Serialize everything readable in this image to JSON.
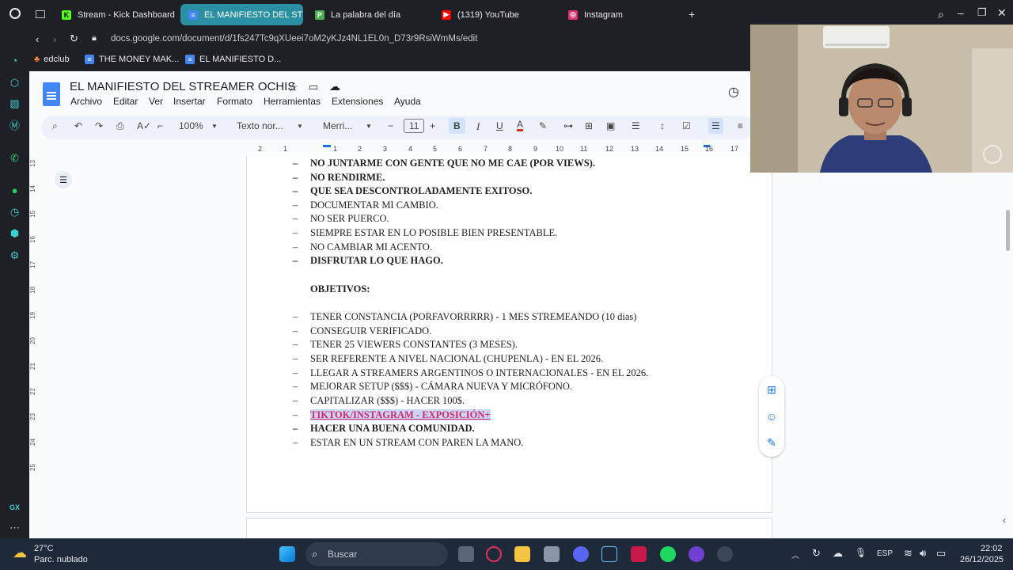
{
  "browser": {
    "tabs": [
      {
        "label": "Stream - Kick Dashboard",
        "icon": "kick-icon",
        "color": "#53fc18"
      },
      {
        "label": "EL MANIFIESTO DEL STR",
        "icon": "docs-icon",
        "color": "#4285f4"
      },
      {
        "label": "La palabra del día",
        "icon": "p-icon",
        "color": "#4caf50"
      },
      {
        "label": "(1319) YouTube",
        "icon": "youtube-icon",
        "color": "#ff0000"
      },
      {
        "label": "Instagram",
        "icon": "instagram-icon",
        "color": "#e1306c"
      }
    ],
    "url": "docs.google.com/document/d/1fs247Tc9qXUeei7oM2yKJz4NL1EL0n_D73r9RsiWmMs/edit",
    "bookmarks": [
      "edclub",
      "THE MONEY MAK...",
      "EL MANIFIESTO D..."
    ]
  },
  "docs": {
    "title": "EL MANIFIESTO DEL STREAMER OCHIS",
    "menu": [
      "Archivo",
      "Editar",
      "Ver",
      "Insertar",
      "Formato",
      "Herramientas",
      "Extensiones",
      "Ayuda"
    ],
    "toolbar": {
      "zoom": "100%",
      "style": "Texto nor...",
      "font": "Merri...",
      "size": "11"
    },
    "ruler_numbers": [
      "2",
      "1",
      "1",
      "2",
      "3",
      "4",
      "5",
      "6",
      "7",
      "8",
      "9",
      "10",
      "11",
      "12",
      "13",
      "14",
      "15",
      "16",
      "17"
    ],
    "vruler_numbers": [
      "13",
      "14",
      "15",
      "16",
      "17",
      "18",
      "19",
      "20",
      "21",
      "22",
      "23",
      "24",
      "25"
    ],
    "lines": [
      {
        "text": "NO JUNTARME CON GENTE QUE NO ME CAE (POR VIEWS).",
        "dash": "–",
        "bold": true
      },
      {
        "text": "NO RENDIRME.",
        "dash": "–",
        "bold": true
      },
      {
        "text": "QUE SEA DESCONTROLADAMENTE EXITOSO.",
        "dash": "–",
        "bold": true
      },
      {
        "text": "DOCUMENTAR MI CAMBIO.",
        "dash": "–",
        "bold": false
      },
      {
        "text": "NO SER PUERCO.",
        "dash": "–",
        "bold": false
      },
      {
        "text": "SIEMPRE ESTAR EN LO POSIBLE BIEN PRESENTABLE.",
        "dash": "–",
        "bold": false
      },
      {
        "text": "NO CAMBIAR MI ACENTO.",
        "dash": "–",
        "bold": false
      },
      {
        "text": "DISFRUTAR LO QUE HAGO.",
        "dash": "–",
        "bold": true
      }
    ],
    "objectives_heading": "OBJETIVOS:",
    "objectives": [
      {
        "text": "TENER CONSTANCIA (PORFAVORRRRR) - 1 MES STREMEANDO (10 dias)",
        "dash": "–",
        "style": "normal"
      },
      {
        "text": "CONSEGUIR VERIFICADO.",
        "dash": "–",
        "style": "normal"
      },
      {
        "text": "TENER 25 VIEWERS CONSTANTES (3 MESES).",
        "dash": "–",
        "style": "normal"
      },
      {
        "text": "SER REFERENTE A NIVEL NACIONAL (CHUPENLA) - EN EL 2026.",
        "dash": "–",
        "style": "normal"
      },
      {
        "text": "LLEGAR A STREAMERS ARGENTINOS O INTERNACIONALES - EN EL 2026.",
        "dash": "–",
        "style": "normal"
      },
      {
        "text": "MEJORAR SETUP ($$$) - CÁMARA NUEVA Y MICRÓFONO.",
        "dash": "–",
        "style": "normal"
      },
      {
        "text": "CAPITALIZAR ($$$) - HACER 100$.",
        "dash": "–",
        "style": "normal"
      },
      {
        "text": "TIKTOK/INSTAGRAM - EXPOSICIÓN+",
        "dash": "–",
        "style": "highlight"
      },
      {
        "text": "HACER UNA BUENA COMUNIDAD.",
        "dash": "–",
        "style": "bold"
      },
      {
        "text": "ESTAR EN UN STREAM CON PAREN LA MANO.",
        "dash": "–",
        "style": "normal"
      }
    ]
  },
  "taskbar": {
    "weather_temp": "27°C",
    "weather_desc": "Parc. nublado",
    "search_placeholder": "Buscar",
    "lang": "ESP",
    "time": "22:02",
    "date": "26/12/2025"
  }
}
